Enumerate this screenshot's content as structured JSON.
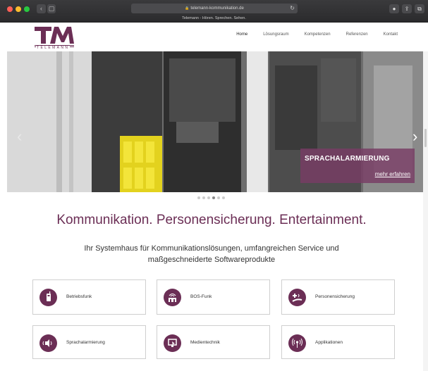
{
  "browser": {
    "url": "telemann-kommunikation.de",
    "tab_title": "Telemann - Hören. Sprechen. Sehen."
  },
  "header": {
    "logo_text": "TELEMANN",
    "nav": [
      {
        "label": "Home",
        "active": true
      },
      {
        "label": "Lösungsraum",
        "active": false
      },
      {
        "label": "Kompetenzen",
        "active": false
      },
      {
        "label": "Referenzen",
        "active": false
      },
      {
        "label": "Kontakt",
        "active": false
      }
    ]
  },
  "slider": {
    "caption_title": "SPRACHALARMIERUNG",
    "caption_link": "mehr erfahren",
    "dot_count": 6,
    "active_dot": 4
  },
  "main": {
    "headline": "Kommunikation. Personensicherung. Entertainment.",
    "subline": "Ihr Systemhaus für Kommunikationslösungen, umfangreichen Service und maßgeschneiderte Softwareprodukte"
  },
  "tiles": [
    {
      "label": "Betriebsfunk",
      "icon": "radio-handset-icon"
    },
    {
      "label": "BOS-Funk",
      "icon": "fire-station-icon"
    },
    {
      "label": "Personensicherung",
      "icon": "person-alarm-icon"
    },
    {
      "label": "Sprachalarmierung",
      "icon": "speaker-icon"
    },
    {
      "label": "Medientechnik",
      "icon": "screen-pointer-icon"
    },
    {
      "label": "Applikationen",
      "icon": "broadcast-icon"
    }
  ],
  "colors": {
    "brand": "#6b2e55",
    "caption_bg": "#783c64"
  }
}
